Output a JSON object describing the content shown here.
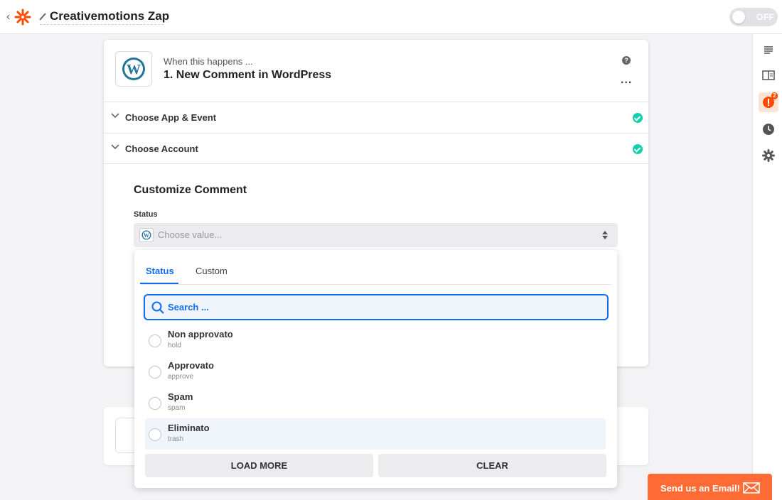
{
  "header": {
    "zap_title": "Creativemotions Zap",
    "toggle_label": "OFF"
  },
  "step": {
    "when_text": "When this happens ...",
    "title": "1. New Comment in WordPress",
    "help": "?",
    "more": "..."
  },
  "sections": [
    {
      "label": "Choose App & Event"
    },
    {
      "label": "Choose Account"
    }
  ],
  "customize": {
    "title": "Customize Comment",
    "field_label": "Status",
    "placeholder": "Choose value..."
  },
  "dropdown": {
    "tabs": [
      {
        "label": "Status"
      },
      {
        "label": "Custom"
      }
    ],
    "search_placeholder": "Search ...",
    "options": [
      {
        "label": "Non approvato",
        "value": "hold"
      },
      {
        "label": "Approvato",
        "value": "approve"
      },
      {
        "label": "Spam",
        "value": "spam"
      },
      {
        "label": "Eliminato",
        "value": "trash"
      }
    ],
    "load_more": "LOAD MORE",
    "clear": "CLEAR"
  },
  "sidebar": {
    "alert_count": "2",
    "icons": [
      "list-icon",
      "book-icon",
      "alert-icon",
      "history-icon",
      "settings-icon"
    ]
  },
  "send_email": {
    "label": "Send us an Email!"
  },
  "colors": {
    "accent": "#136bf5",
    "brand": "#ff4a00",
    "success": "#13d0ab",
    "email_button": "#ff6b35"
  }
}
